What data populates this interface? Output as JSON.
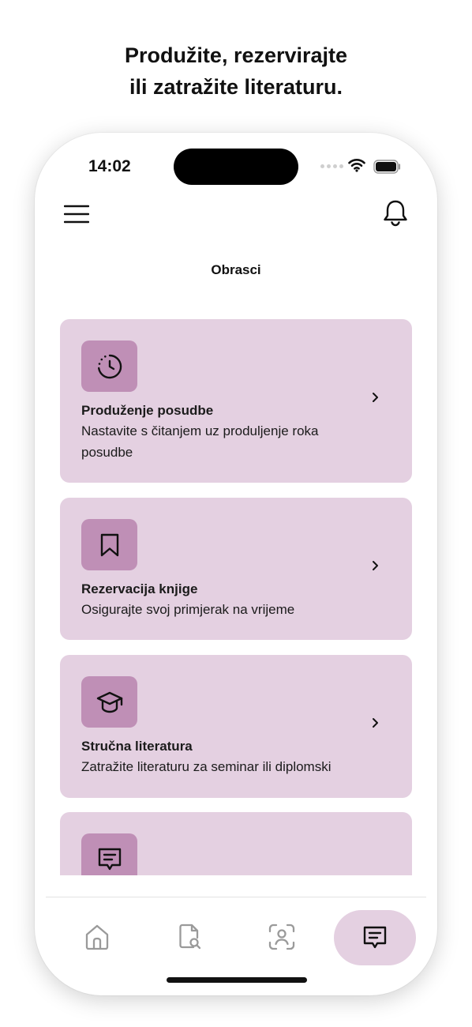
{
  "headline": {
    "line1": "Produžite, rezervirajte",
    "line2": "ili zatražite literaturu."
  },
  "status_bar": {
    "time": "14:02",
    "icons": [
      "signal-dots-icon",
      "wifi-icon",
      "battery-icon"
    ]
  },
  "header": {
    "menu_icon": "hamburger-menu-icon",
    "notification_icon": "bell-icon"
  },
  "page": {
    "title": "Obrasci"
  },
  "forms": [
    {
      "icon": "clock-history-icon",
      "title": "Produženje posudbe",
      "description": "Nastavite s čitanjem uz produljenje roka posudbe"
    },
    {
      "icon": "bookmark-icon",
      "title": "Rezervacija knjige",
      "description": "Osigurajte svoj primjerak na vrijeme"
    },
    {
      "icon": "graduation-cap-icon",
      "title": "Stručna literatura",
      "description": "Zatražite literaturu za seminar ili diplomski"
    },
    {
      "icon": "message-square-icon",
      "title": "",
      "description": ""
    }
  ],
  "tab_bar": {
    "tabs": [
      {
        "icon": "home-icon",
        "active": false
      },
      {
        "icon": "document-search-icon",
        "active": false
      },
      {
        "icon": "scan-user-icon",
        "active": false
      },
      {
        "icon": "message-square-icon",
        "active": true
      }
    ]
  },
  "colors": {
    "card_background": "#e4d0e1",
    "icon_tile": "#bf8fb6",
    "active_tab": "#e4d0e1",
    "text": "#1b1b1b"
  }
}
